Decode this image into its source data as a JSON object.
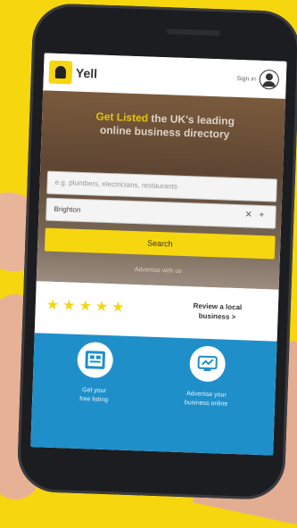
{
  "header": {
    "logo_text": "Yell",
    "signin_label": "Sign in",
    "avatar_icon": "user-avatar-icon"
  },
  "hero": {
    "headline_accent": "Get Listed",
    "headline_rest": " the UK's leading",
    "headline_line2": "online business directory",
    "search_what_placeholder": "e.g. plumbers, electricians, restaurants",
    "search_where_value": "Brighton",
    "search_button_label": "Search",
    "sub_link": "Advertise with us"
  },
  "reviews": {
    "stars": [
      "★",
      "★",
      "★",
      "★",
      "★"
    ],
    "link_line1": "Review a local",
    "link_line2": "business >"
  },
  "features": [
    {
      "icon": "listing-icon",
      "line1": "Get your",
      "line2": "free listing"
    },
    {
      "icon": "advertise-icon",
      "line1": "Advertise your",
      "line2": "business online"
    }
  ],
  "colors": {
    "brand_yellow": "#f6d60e",
    "feature_blue": "#1f8fca"
  }
}
